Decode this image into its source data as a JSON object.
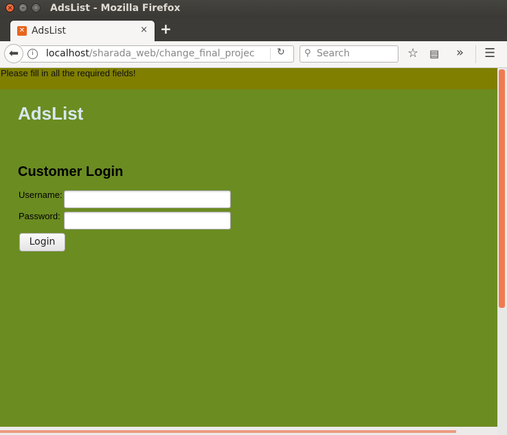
{
  "window": {
    "title": "AdsList - Mozilla Firefox",
    "buttons": {
      "close": "×",
      "minimize": "–",
      "maximize": "□"
    }
  },
  "tabs": [
    {
      "label": "AdsList",
      "favicon": "xampp-icon",
      "close": "×"
    }
  ],
  "new_tab_label": "+",
  "nav": {
    "url_host": "localhost",
    "url_path": "/sharada_web/change_final_projec",
    "search_placeholder": "Search",
    "icons": [
      "back-arrow-icon",
      "info-icon",
      "reload-icon",
      "search-icon",
      "bookmark-star-icon",
      "reading-list-icon",
      "overflow-chevrons-icon",
      "hamburger-menu-icon"
    ]
  },
  "page": {
    "alert": "Please fill in all the required fields!",
    "site_title": "AdsList",
    "login_heading": "Customer Login",
    "username_label": "Username:",
    "password_label": "Password:",
    "username_value": "",
    "password_value": "",
    "login_button": "Login"
  },
  "colors": {
    "page_bg": "#6b8c21",
    "alert_bg": "#807f00",
    "title_color": "#d7e8f0",
    "scroll_thumb": "#f07b50"
  }
}
